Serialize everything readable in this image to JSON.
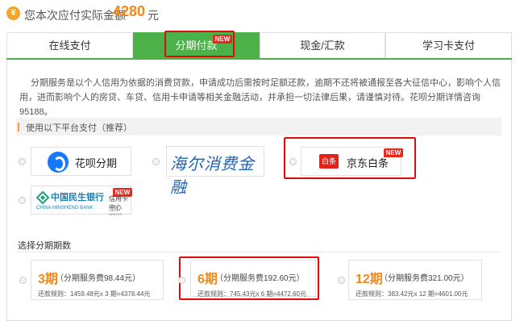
{
  "header": {
    "label": "您本次应付实际金额",
    "amount": "4280",
    "unit": "元",
    "icon": "yen-icon"
  },
  "tabs": [
    {
      "label": "在线支付",
      "active": false
    },
    {
      "label": "分期付款",
      "active": true,
      "badge": "NEW"
    },
    {
      "label": "现金/汇款",
      "active": false
    },
    {
      "label": "学习卡支付",
      "active": false
    }
  ],
  "description": "分期服务是以个人信用为依据的消费贷款，申请成功后需按时足额还款，逾期不还将被通报至各大征信中心，影响个人信用，进而影响个人的房贷、车贷、信用卡申请等相关金融活动，并承担一切法律后果，请谨慎对待。花呗分期详情咨询95188。",
  "platform_section": {
    "title": "使用以下平台支付（推荐）"
  },
  "platforms": [
    {
      "name": "花呗分期"
    },
    {
      "name": "海尔消费金融"
    },
    {
      "name": "京东白条",
      "logo_text": "白条",
      "badge": "NEW"
    },
    {
      "name": "中国民生银行",
      "name_en": "CHINA MINSHENG BANK",
      "card_text": "信用卡中心",
      "card_sub": "CREDIT CARD CENTER",
      "badge": "NEW"
    }
  ],
  "installment_section": {
    "title": "选择分期期数"
  },
  "plans": [
    {
      "period": "3期",
      "fee": "（分期服务费98.44元）",
      "rule": "还款规则：1459.48元x 3 期=4378.44元"
    },
    {
      "period": "6期",
      "fee": "（分期服务费192.60元）",
      "rule": "还款规则：745.43元x 6 期=4472.60元"
    },
    {
      "period": "12期",
      "fee": "（分期服务费321.00元）",
      "rule": "还款规则：383.42元x 12 期=4601.00元"
    }
  ],
  "colors": {
    "accent_green": "#4db14a",
    "amount_orange": "#f08a1c",
    "highlight_red": "#e10b0b",
    "badge_red": "#e8271d"
  }
}
